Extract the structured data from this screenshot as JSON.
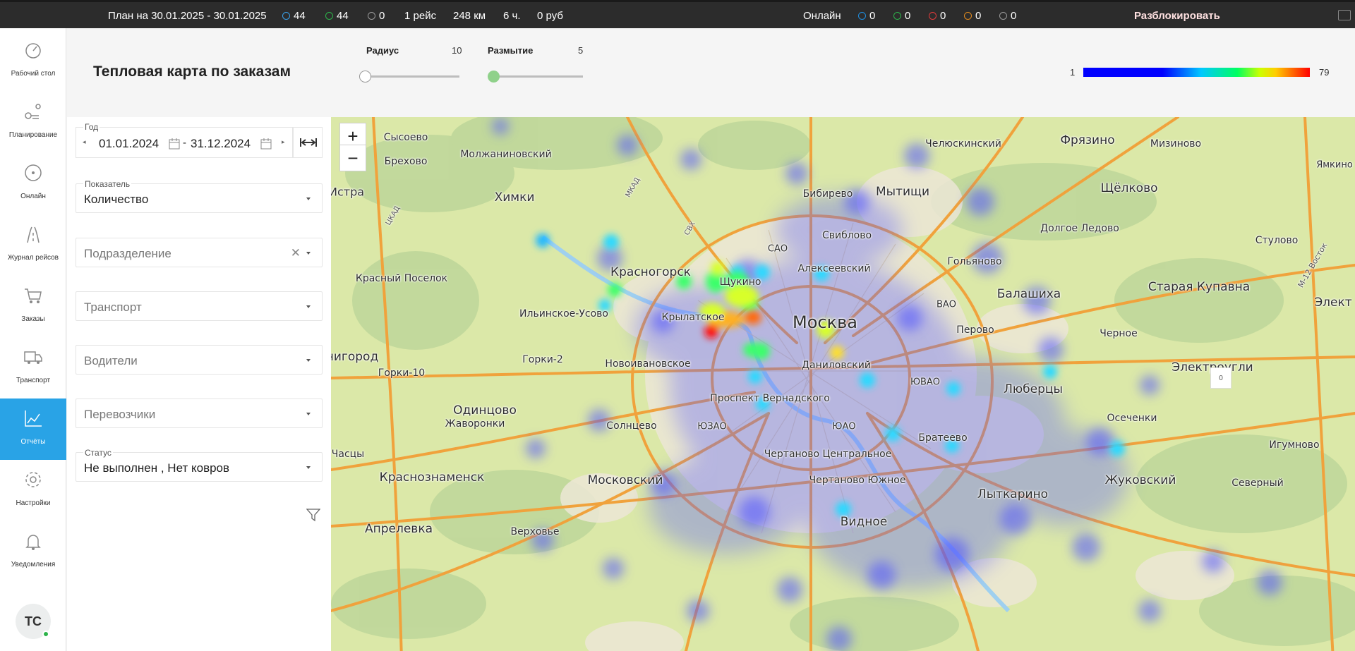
{
  "topbar": {
    "plan": "План на 30.01.2025 - 30.01.2025",
    "count_blue": "44",
    "count_green": "44",
    "count_gray": "0",
    "trips": "1 рейс",
    "distance": "248 км",
    "hours": "6 ч.",
    "cost": "0 руб",
    "online_label": "Онлайн",
    "online_counts": [
      "0",
      "0",
      "0",
      "0",
      "0"
    ],
    "online_colors": [
      "#1f8fe0",
      "#2db34a",
      "#e03a3a",
      "#e08a1f",
      "#9a9a9a"
    ],
    "unlock": "Разблокировать"
  },
  "sidebar": {
    "items": [
      {
        "label": "Рабочий стол",
        "icon": "speedometer-icon"
      },
      {
        "label": "Планирование",
        "icon": "route-planning-icon"
      },
      {
        "label": "Онлайн",
        "icon": "compass-icon"
      },
      {
        "label": "Журнал рейсов",
        "icon": "road-icon"
      },
      {
        "label": "Заказы",
        "icon": "cart-icon"
      },
      {
        "label": "Транспорт",
        "icon": "truck-icon"
      },
      {
        "label": "Отчёты",
        "icon": "chart-icon"
      },
      {
        "label": "Настройки",
        "icon": "gear-icon"
      },
      {
        "label": "Уведомления",
        "icon": "bell-icon"
      }
    ],
    "active_index": 6,
    "avatar": "TC"
  },
  "header": {
    "title": "Тепловая карта по заказам",
    "radius_label": "Радиус",
    "radius_value": "10",
    "blur_label": "Размытие",
    "blur_value": "5",
    "legend_min": "1",
    "legend_max": "79"
  },
  "filters": {
    "year_label": "Год",
    "date_from": "01.01.2024",
    "date_sep": "-",
    "date_to": "31.12.2024",
    "indicator_label": "Показатель",
    "indicator_value": "Количество",
    "division_placeholder": "Подразделение",
    "transport_placeholder": "Транспорт",
    "drivers_placeholder": "Водители",
    "carriers_placeholder": "Перевозчики",
    "status_label": "Статус",
    "status_value": "Не выполнен ,  Нет ковров"
  },
  "map": {
    "zoom_in": "+",
    "zoom_out": "−",
    "badge": "0",
    "labels": [
      {
        "text": "Сысоево",
        "size": 14
      },
      {
        "text": "Брехово",
        "size": 14
      },
      {
        "text": "Молжаниновский",
        "size": 14
      },
      {
        "text": "Истра",
        "size": 16
      },
      {
        "text": "Химки",
        "size": 17
      },
      {
        "text": "Бибирево",
        "size": 14
      },
      {
        "text": "Мытищи",
        "size": 17
      },
      {
        "text": "Челюскинский",
        "size": 14
      },
      {
        "text": "Фрязино",
        "size": 17
      },
      {
        "text": "Мизиново",
        "size": 14
      },
      {
        "text": "Щёлково",
        "size": 17
      },
      {
        "text": "Ямкино",
        "size": 13
      },
      {
        "text": "Свиблово",
        "size": 14
      },
      {
        "text": "САО",
        "size": 13
      },
      {
        "text": "Долгое Ледово",
        "size": 14
      },
      {
        "text": "Стулово",
        "size": 14
      },
      {
        "text": "Красногорск",
        "size": 17
      },
      {
        "text": "Алексеевский",
        "size": 14
      },
      {
        "text": "Гольяново",
        "size": 14
      },
      {
        "text": "Красный Поселок",
        "size": 14
      },
      {
        "text": "Щукино",
        "size": 14
      },
      {
        "text": "Балашиха",
        "size": 17
      },
      {
        "text": "Старая Купавна",
        "size": 17
      },
      {
        "text": "ВАО",
        "size": 13
      },
      {
        "text": "Ильинское-Усово",
        "size": 14
      },
      {
        "text": "Крылатское",
        "size": 14
      },
      {
        "text": "Москва",
        "size": 24
      },
      {
        "text": "Перово",
        "size": 14
      },
      {
        "text": "Черное",
        "size": 14
      },
      {
        "text": "Элект",
        "size": 17
      },
      {
        "text": "нигород",
        "size": 17
      },
      {
        "text": "Горки-2",
        "size": 14
      },
      {
        "text": "Новоивановское",
        "size": 14
      },
      {
        "text": "Даниловский",
        "size": 14
      },
      {
        "text": "Горки-10",
        "size": 14
      },
      {
        "text": "ЮВАО",
        "size": 13
      },
      {
        "text": "Люберцы",
        "size": 17
      },
      {
        "text": "Электроугли",
        "size": 17
      },
      {
        "text": "Одинцово",
        "size": 17
      },
      {
        "text": "Проспект Вернадского",
        "size": 14
      },
      {
        "text": "Жаворонки",
        "size": 14
      },
      {
        "text": "Солнцево",
        "size": 14
      },
      {
        "text": "ЮЗАО",
        "size": 13
      },
      {
        "text": "ЮАО",
        "size": 13
      },
      {
        "text": "Осеченки",
        "size": 14
      },
      {
        "text": "Братеево",
        "size": 14
      },
      {
        "text": "Часцы",
        "size": 14
      },
      {
        "text": "Игумново",
        "size": 14
      },
      {
        "text": "Чертаново Центральное",
        "size": 14
      },
      {
        "text": "Краснознаменск",
        "size": 17
      },
      {
        "text": "Московский",
        "size": 17
      },
      {
        "text": "Чертаново Южное",
        "size": 14
      },
      {
        "text": "Жуковский",
        "size": 17
      },
      {
        "text": "Северный",
        "size": 14
      },
      {
        "text": "Лыткарино",
        "size": 17
      },
      {
        "text": "Апрелевка",
        "size": 17
      },
      {
        "text": "Верховье",
        "size": 14
      },
      {
        "text": "Видное",
        "size": 17
      },
      {
        "text": "М-12 Восток",
        "size": 11
      },
      {
        "text": "МКАД",
        "size": 10
      },
      {
        "text": "ЦКАД",
        "size": 10
      },
      {
        "text": "СВХ",
        "size": 10
      }
    ]
  }
}
